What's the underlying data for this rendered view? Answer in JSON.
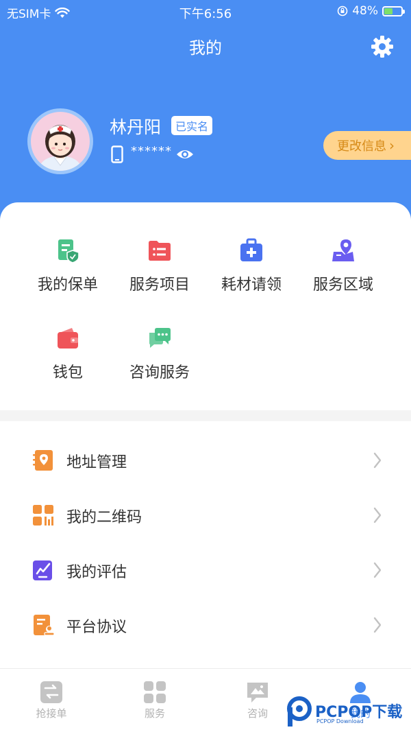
{
  "status_bar": {
    "carrier": "无SIM卡",
    "time": "下午6:56",
    "battery": "48%",
    "battery_level": 0.48
  },
  "nav": {
    "title": "我的"
  },
  "profile": {
    "name": "林丹阳",
    "verified_badge": "已实名",
    "phone_masked": "******",
    "edit_button": "更改信息"
  },
  "grid": [
    {
      "label": "我的保单",
      "icon": "policy-icon",
      "color": "#4cc38a"
    },
    {
      "label": "服务项目",
      "icon": "service-folder-icon",
      "color": "#ef5459"
    },
    {
      "label": "耗材请领",
      "icon": "medical-kit-icon",
      "color": "#4a72f0"
    },
    {
      "label": "服务区域",
      "icon": "map-pin-icon",
      "color": "#6a5df0"
    },
    {
      "label": "钱包",
      "icon": "wallet-icon",
      "color": "#ef5459"
    },
    {
      "label": "咨询服务",
      "icon": "chat-icon",
      "color": "#4cc38a"
    }
  ],
  "menu": [
    {
      "label": "地址管理",
      "icon": "address-book-icon",
      "color": "#f2913a"
    },
    {
      "label": "我的二维码",
      "icon": "qr-code-icon",
      "color": "#f2913a"
    },
    {
      "label": "我的评估",
      "icon": "assessment-icon",
      "color": "#6a4fe8"
    },
    {
      "label": "平台协议",
      "icon": "agreement-icon",
      "color": "#f2913a"
    }
  ],
  "tabs": [
    {
      "label": "抢接单",
      "icon": "grab-order-icon"
    },
    {
      "label": "服务",
      "icon": "service-grid-icon"
    },
    {
      "label": "咨询",
      "icon": "consult-icon"
    },
    {
      "label": "我的",
      "icon": "profile-icon",
      "active": true
    }
  ],
  "watermark": {
    "text": "PCPOP下载",
    "sub": "PCPOP Download"
  },
  "colors": {
    "brand_blue": "#4a8ef3",
    "edit_bg": "#ffd48e",
    "edit_text": "#d68a17"
  }
}
